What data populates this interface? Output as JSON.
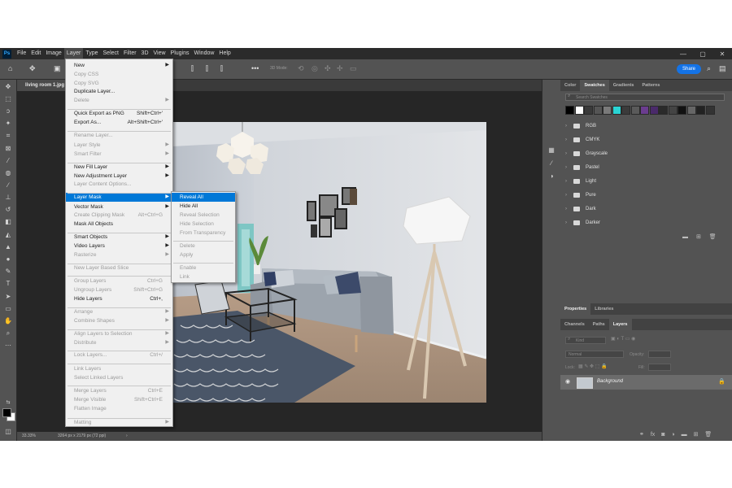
{
  "app": {
    "logo": "Ps",
    "menubar": [
      "File",
      "Edit",
      "Image",
      "Layer",
      "Type",
      "Select",
      "Filter",
      "3D",
      "View",
      "Plugins",
      "Window",
      "Help"
    ],
    "active_menu": "Layer",
    "window_controls": [
      "—",
      "▢",
      "✕"
    ]
  },
  "options_bar": {
    "mode_label": "3D Mode:",
    "share_label": "Share"
  },
  "document": {
    "tab_title": "living room 1.jpg",
    "zoom": "33.33%",
    "doc_info": "3264 px x 2179 px (72 ppi)"
  },
  "layer_menu": {
    "items": [
      {
        "label": "New",
        "shortcut": "",
        "submenu": true,
        "disabled": false
      },
      {
        "label": "Copy CSS",
        "shortcut": "",
        "submenu": false,
        "disabled": true
      },
      {
        "label": "Copy SVG",
        "shortcut": "",
        "submenu": false,
        "disabled": true
      },
      {
        "label": "Duplicate Layer...",
        "shortcut": "",
        "submenu": false,
        "disabled": false
      },
      {
        "label": "Delete",
        "shortcut": "",
        "submenu": true,
        "disabled": true
      },
      {
        "label": "Quick Export as PNG",
        "shortcut": "Shift+Ctrl+'",
        "submenu": false,
        "disabled": false
      },
      {
        "label": "Export As...",
        "shortcut": "Alt+Shift+Ctrl+'",
        "submenu": false,
        "disabled": false
      },
      {
        "label": "Rename Layer...",
        "shortcut": "",
        "submenu": false,
        "disabled": true
      },
      {
        "label": "Layer Style",
        "shortcut": "",
        "submenu": true,
        "disabled": true
      },
      {
        "label": "Smart Filter",
        "shortcut": "",
        "submenu": true,
        "disabled": true
      },
      {
        "label": "New Fill Layer",
        "shortcut": "",
        "submenu": true,
        "disabled": false
      },
      {
        "label": "New Adjustment Layer",
        "shortcut": "",
        "submenu": true,
        "disabled": false
      },
      {
        "label": "Layer Content Options...",
        "shortcut": "",
        "submenu": false,
        "disabled": true
      },
      {
        "label": "Layer Mask",
        "shortcut": "",
        "submenu": true,
        "disabled": false,
        "highlighted": true
      },
      {
        "label": "Vector Mask",
        "shortcut": "",
        "submenu": true,
        "disabled": false
      },
      {
        "label": "Create Clipping Mask",
        "shortcut": "Alt+Ctrl+G",
        "submenu": false,
        "disabled": true
      },
      {
        "label": "Mask All Objects",
        "shortcut": "",
        "submenu": false,
        "disabled": false
      },
      {
        "label": "Smart Objects",
        "shortcut": "",
        "submenu": true,
        "disabled": false
      },
      {
        "label": "Video Layers",
        "shortcut": "",
        "submenu": true,
        "disabled": false
      },
      {
        "label": "Rasterize",
        "shortcut": "",
        "submenu": true,
        "disabled": true
      },
      {
        "label": "New Layer Based Slice",
        "shortcut": "",
        "submenu": false,
        "disabled": true
      },
      {
        "label": "Group Layers",
        "shortcut": "Ctrl+G",
        "submenu": false,
        "disabled": true
      },
      {
        "label": "Ungroup Layers",
        "shortcut": "Shift+Ctrl+G",
        "submenu": false,
        "disabled": true
      },
      {
        "label": "Hide Layers",
        "shortcut": "Ctrl+,",
        "submenu": false,
        "disabled": false
      },
      {
        "label": "Arrange",
        "shortcut": "",
        "submenu": true,
        "disabled": true
      },
      {
        "label": "Combine Shapes",
        "shortcut": "",
        "submenu": true,
        "disabled": true
      },
      {
        "label": "Align Layers to Selection",
        "shortcut": "",
        "submenu": true,
        "disabled": true
      },
      {
        "label": "Distribute",
        "shortcut": "",
        "submenu": true,
        "disabled": true
      },
      {
        "label": "Lock Layers...",
        "shortcut": "Ctrl+/",
        "submenu": false,
        "disabled": true
      },
      {
        "label": "Link Layers",
        "shortcut": "",
        "submenu": false,
        "disabled": true
      },
      {
        "label": "Select Linked Layers",
        "shortcut": "",
        "submenu": false,
        "disabled": true
      },
      {
        "label": "Merge Layers",
        "shortcut": "Ctrl+E",
        "submenu": false,
        "disabled": true
      },
      {
        "label": "Merge Visible",
        "shortcut": "Shift+Ctrl+E",
        "submenu": false,
        "disabled": true
      },
      {
        "label": "Flatten Image",
        "shortcut": "",
        "submenu": false,
        "disabled": true
      },
      {
        "label": "Matting",
        "shortcut": "",
        "submenu": true,
        "disabled": true
      }
    ]
  },
  "layer_mask_submenu": {
    "items": [
      {
        "label": "Reveal All",
        "disabled": false,
        "highlighted": true
      },
      {
        "label": "Hide All",
        "disabled": false
      },
      {
        "label": "Reveal Selection",
        "disabled": true
      },
      {
        "label": "Hide Selection",
        "disabled": true
      },
      {
        "label": "From Transparency",
        "disabled": true
      },
      {
        "label": "Delete",
        "disabled": true
      },
      {
        "label": "Apply",
        "disabled": true
      },
      {
        "label": "Enable",
        "disabled": true
      },
      {
        "label": "Link",
        "disabled": true
      }
    ]
  },
  "swatches_panel": {
    "tabs": [
      "Color",
      "Swatches",
      "Gradients",
      "Patterns"
    ],
    "active_tab": "Swatches",
    "search_placeholder": "Search Swatches",
    "recent_colors": [
      "#000000",
      "#ffffff",
      "#3a3a3a",
      "#555555",
      "#7a7a7a",
      "#2ad4d4",
      "#3b3b3b",
      "#5a5a5a",
      "#6b3d8f",
      "#4a2a6a",
      "#2a2a2a",
      "#444444",
      "#111111",
      "#666666",
      "#222222",
      "#333333"
    ],
    "folders": [
      "RGB",
      "CMYK",
      "Grayscale",
      "Pastel",
      "Light",
      "Pure",
      "Dark",
      "Darker"
    ]
  },
  "properties_panel": {
    "tabs": [
      "Properties",
      "Libraries"
    ],
    "active_tab": "Properties"
  },
  "layers_panel": {
    "tabs": [
      "Channels",
      "Paths",
      "Layers"
    ],
    "active_tab": "Layers",
    "kind_label": "Kind",
    "blend_mode": "Normal",
    "opacity_label": "Opacity:",
    "lock_label": "Lock:",
    "fill_label": "Fill:",
    "layer_name": "Background"
  }
}
